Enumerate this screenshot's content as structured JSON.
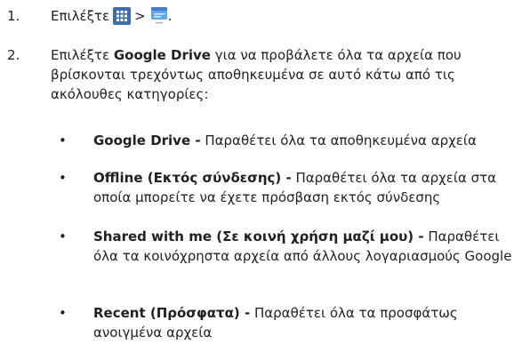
{
  "steps": [
    {
      "number": "1.",
      "text_before": "Επιλέξτε",
      "separator": ">",
      "text_after": ".",
      "icons": [
        "apps-grid-icon",
        "file-manager-icon"
      ]
    },
    {
      "number": "2.",
      "text_before": "Επιλέξτε ",
      "bold": "Google Drive",
      "text_after": " για να προβάλετε όλα τα αρχεία που βρίσκονται τρεχόντως αποθηκευμένα σε αυτό κάτω από τις ακόλουθες κατηγορίες:"
    }
  ],
  "bullets": [
    {
      "marker": "•",
      "bold": "Google Drive -",
      "text": " Παραθέτει όλα τα αποθηκευμένα αρχεία"
    },
    {
      "marker": "•",
      "bold": "Offline (Εκτός σύνδεσης) -",
      "text": " Παραθέτει όλα τα αρχεία στα οποία μπορείτε να έχετε πρόσβαση εκτός σύνδεσης"
    },
    {
      "marker": "•",
      "bold": "Shared with me (Σε κοινή χρήση μαζί μου) -",
      "text": " Παραθέτει όλα τα κοινόχρηστα αρχεία από άλλους λογαριασμούς Google"
    },
    {
      "marker": "•",
      "bold": "Recent (Πρόσφατα) -",
      "text": " Παραθέτει όλα τα προσφάτως ανοιγμένα αρχεία"
    }
  ],
  "colors": {
    "text": "#231f20",
    "apps_icon_bg": "#3a6fb0",
    "files_icon_top": "#3d7fd0",
    "files_icon_body": "#5da8f0"
  }
}
